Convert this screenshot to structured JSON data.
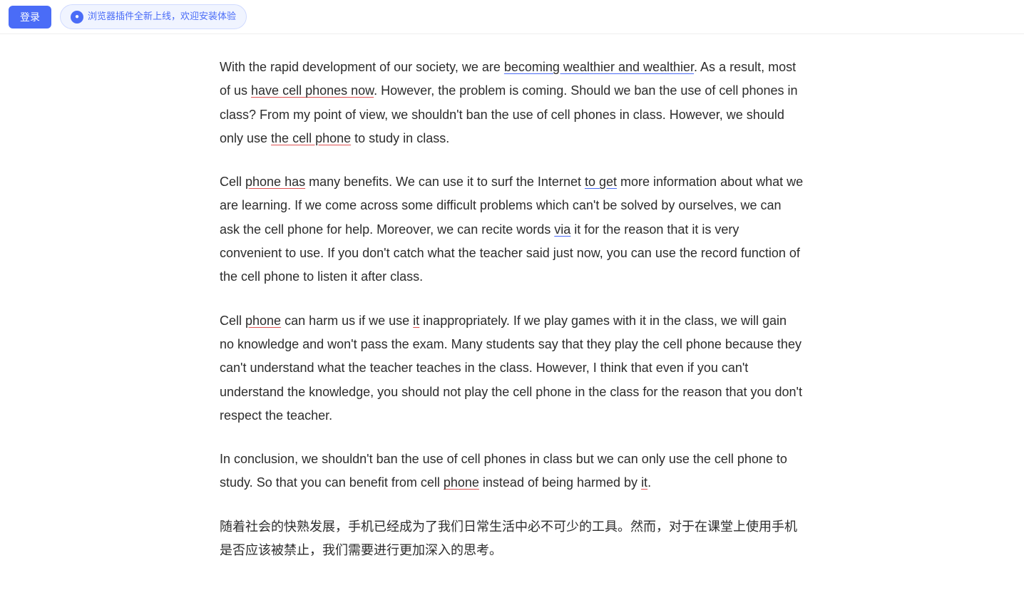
{
  "topbar": {
    "login_label": "登录",
    "plugin_text": "浏览器插件全新上线，欢迎安装体验"
  },
  "content": {
    "paragraph1": {
      "text": "With the rapid development of our society, we are becoming wealthier and wealthier. As a result, most of us have cell phones now. However, the problem is coming. Should we ban the use of cell phones in class? From my point of view, we shouldn’t ban the use of cell phones in class. However, we should only use the cell phone to study in class."
    },
    "paragraph2": {
      "text": "Cell phone has many benefits. We can use it to surf the Internet to get more information about what we are learning. If we come across some difficult problems which can’t be solved by ourselves, we can ask the cell phone for help. Moreover, we can recite words via it for the reason that it is very convenient to use. If you don’t catch what the teacher said just now, you can use the record function of the cell phone to listen it after class."
    },
    "paragraph3": {
      "text": "Cell phone can harm us if we use it inappropriately. If we play games with it in the class, we will gain no knowledge and won’t pass the exam. Many students say that they play the cell phone because they can’t understand what the teacher teaches in the class. However, I think that even if you can’t understand the knowledge, you should not play the cell phone in the class for the reason that you don’t respect the teacher."
    },
    "paragraph4": {
      "text": "In conclusion, we shouldn’t ban the use of cell phones in class but we can only use the cell phone to study. So that you can benefit from cell phone instead of being harmed by it."
    },
    "paragraph5": {
      "text": "随着社会的快熟发展，手机已经成为了我们日常生活中必不可少的工具。然而，对于在课堂上使用手机是否应该被禁止，我们需要进行更加深入的思考。"
    }
  }
}
